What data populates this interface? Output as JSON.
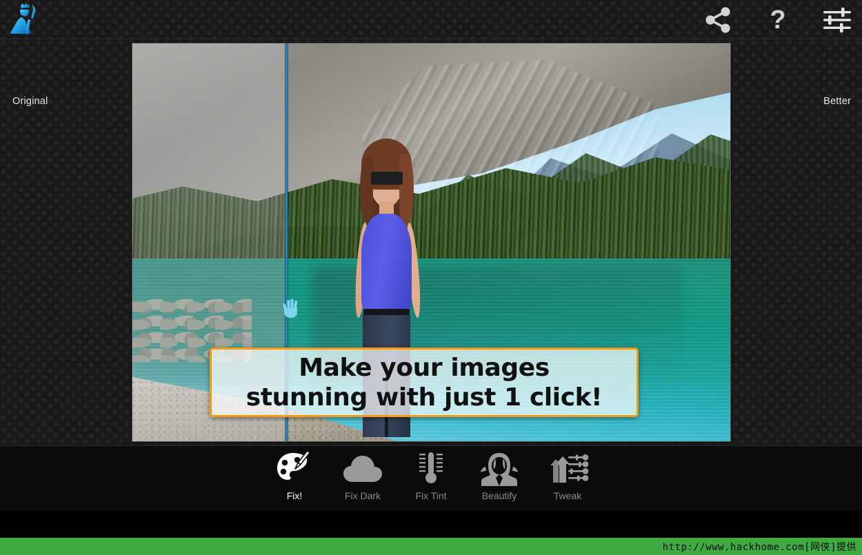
{
  "app": {
    "logo_icon": "photo-editor-logo-icon"
  },
  "topbar": {
    "share_icon": "share-icon",
    "help_icon": "help-question-icon",
    "settings_icon": "settings-sliders-icon"
  },
  "stage": {
    "label_original": "Original",
    "label_better": "Better",
    "divider_color": "#1e88c8",
    "hand_cursor_icon": "hand-drag-icon",
    "hand_cursor_color": "#7fd4ef",
    "photo_alt": "Before/after comparison of a woman standing by a turquoise mountain lake"
  },
  "banner": {
    "line1": "Make your images",
    "line2": "stunning with just 1 click!",
    "border_color": "#f39c12"
  },
  "toolbar": {
    "items": [
      {
        "label": "Fix!",
        "icon": "palette-brush-icon",
        "active": true
      },
      {
        "label": "Fix Dark",
        "icon": "cloud-icon",
        "active": false
      },
      {
        "label": "Fix Tint",
        "icon": "thermometer-icon",
        "active": false
      },
      {
        "label": "Beautify",
        "icon": "female-portrait-icon",
        "active": false
      },
      {
        "label": "Tweak",
        "icon": "arrows-sliders-icon",
        "active": false
      }
    ]
  },
  "footer": {
    "watermark": "http://www.hackhome.com[网侠]提供",
    "bar_color": "#3faa41"
  }
}
